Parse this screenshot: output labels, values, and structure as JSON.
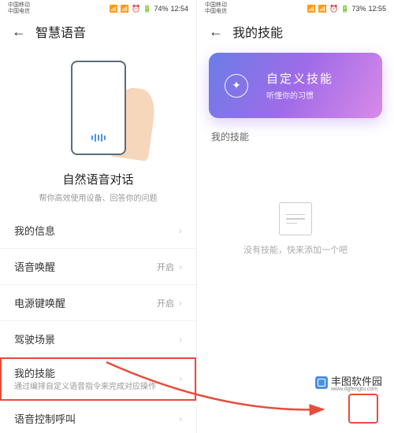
{
  "leftPhone": {
    "statusCarrier1": "中国移动",
    "statusCarrier2": "中国电信",
    "battery": "74%",
    "time": "12:54",
    "headerTitle": "智慧语音",
    "heroTitle": "自然语音对话",
    "heroSub": "帮你高效使用设备、回答你的问题",
    "items": [
      {
        "label": "我的信息",
        "value": ""
      },
      {
        "label": "语音唤醒",
        "value": "开启"
      },
      {
        "label": "电源键唤醒",
        "value": "开启"
      },
      {
        "label": "驾驶场景",
        "value": ""
      }
    ],
    "highlightedItem": {
      "label": "我的技能",
      "subtitle": "通过编排自定义语音指令来完成对应操作"
    },
    "lastItem": {
      "label": "语音控制呼叫",
      "value": ""
    }
  },
  "rightPhone": {
    "statusCarrier1": "中国移动",
    "statusCarrier2": "中国电信",
    "battery": "73%",
    "time": "12:55",
    "headerTitle": "我的技能",
    "cardTitle": "自定义技能",
    "cardSub": "听懂你的习惯",
    "sectionLabel": "我的技能",
    "emptyText": "没有技能，快来添加一个吧"
  },
  "watermark": {
    "brand": "丰图软件园",
    "url": "www.dgfengtu.com"
  },
  "colors": {
    "highlight": "#e74c3c",
    "gradientStart": "#6a7de8",
    "gradientEnd": "#d88ae8"
  }
}
